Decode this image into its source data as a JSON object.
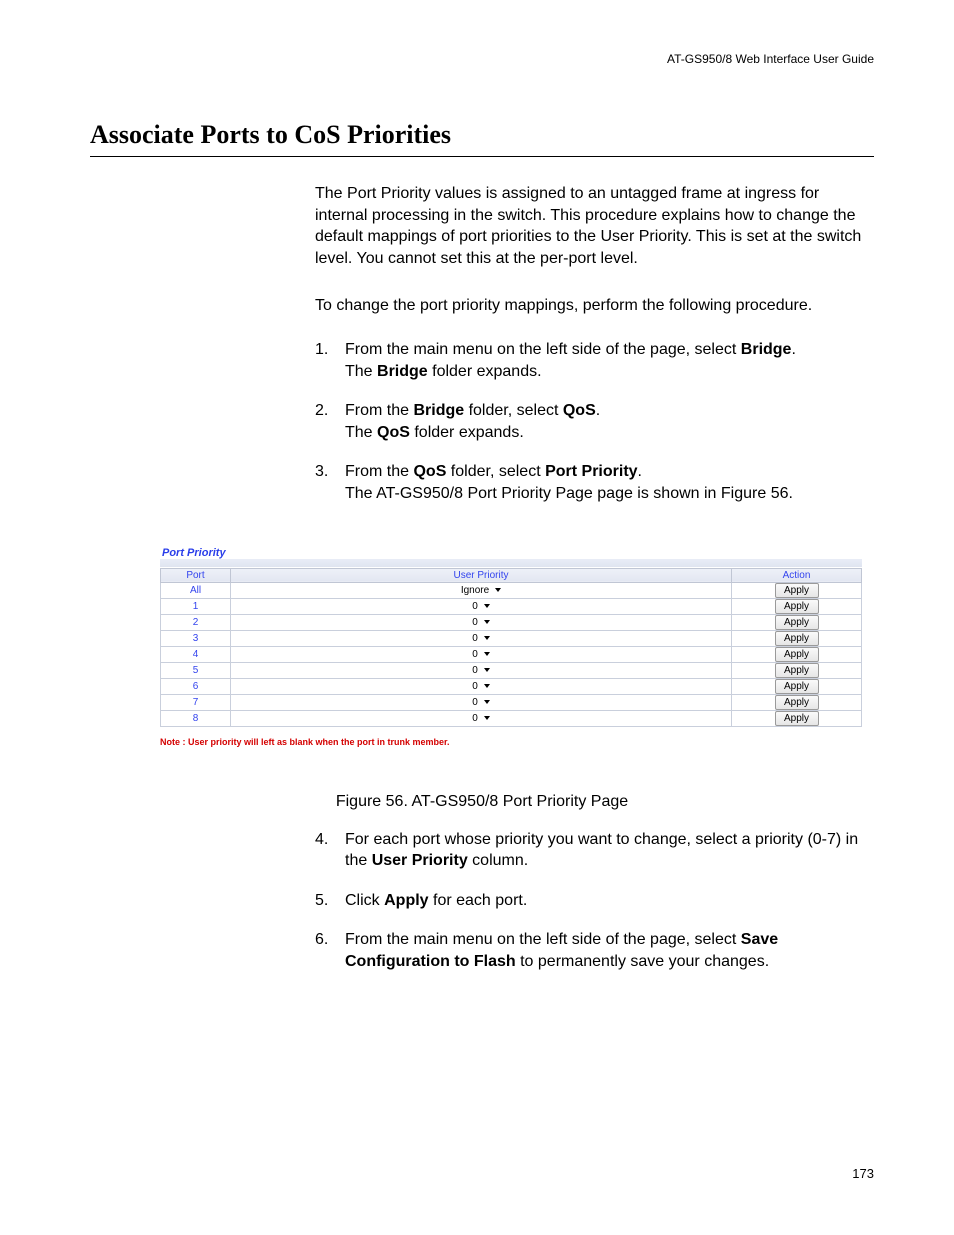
{
  "header": {
    "running": "AT-GS950/8  Web Interface User Guide"
  },
  "title": "Associate Ports to CoS Priorities",
  "intro": {
    "p1": "The Port Priority values is assigned to an untagged frame at ingress for internal processing in the switch. This procedure explains how to change the default mappings of port priorities to the User Priority. This is set at the switch level. You cannot set this at the per-port level.",
    "p2": "To change the port priority mappings, perform the following procedure."
  },
  "steps_part1": [
    {
      "pre": "From the main menu on the left side of the page, select ",
      "b1": "Bridge",
      "post1": ".",
      "line2a": "The ",
      "line2b": "Bridge",
      "line2c": " folder expands."
    },
    {
      "pre": "From the ",
      "b1": "Bridge",
      "mid": " folder, select ",
      "b2": "QoS",
      "post1": ".",
      "line2a": "The ",
      "line2b": "QoS",
      "line2c": " folder expands."
    },
    {
      "pre": "From the ",
      "b1": "QoS",
      "mid": " folder, select ",
      "b2": "Port Priority",
      "post1": ".",
      "line2": "The AT-GS950/8 Port Priority Page page is shown in Figure 56."
    }
  ],
  "figure": {
    "panel_title": "Port Priority",
    "columns": {
      "port": "Port",
      "user_priority": "User Priority",
      "action": "Action"
    },
    "rows": [
      {
        "port": "All",
        "priority": "Ignore",
        "action": "Apply"
      },
      {
        "port": "1",
        "priority": "0",
        "action": "Apply"
      },
      {
        "port": "2",
        "priority": "0",
        "action": "Apply"
      },
      {
        "port": "3",
        "priority": "0",
        "action": "Apply"
      },
      {
        "port": "4",
        "priority": "0",
        "action": "Apply"
      },
      {
        "port": "5",
        "priority": "0",
        "action": "Apply"
      },
      {
        "port": "6",
        "priority": "0",
        "action": "Apply"
      },
      {
        "port": "7",
        "priority": "0",
        "action": "Apply"
      },
      {
        "port": "8",
        "priority": "0",
        "action": "Apply"
      }
    ],
    "note": "Note : User priority will left as blank when the port in trunk member.",
    "caption": "Figure 56. AT-GS950/8 Port Priority Page"
  },
  "steps_part2": [
    {
      "pre": "For each port whose priority you want to change, select a priority (0-7) in the ",
      "b1": "User Priority",
      "post1": " column."
    },
    {
      "pre": "Click ",
      "b1": "Apply",
      "post1": " for each port."
    },
    {
      "pre": "From the main menu on the left side of the page, select ",
      "b1": "Save Configuration to Flash",
      "post1": " to permanently save your changes."
    }
  ],
  "page_number": "173"
}
